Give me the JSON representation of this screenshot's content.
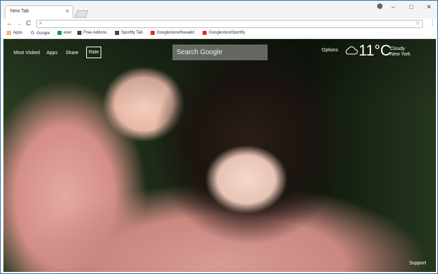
{
  "tab": {
    "title": "New Tab",
    "close": "×"
  },
  "window_controls": {
    "minimize": "–",
    "maximize": "□",
    "close": "✕"
  },
  "toolbar": {
    "back": "←",
    "forward": "→",
    "reload": "C",
    "search_icon": "⌕",
    "star": "☆",
    "menu": "⋮"
  },
  "bookmarks": [
    {
      "label": "Apps",
      "icon": "apps-grid-icon",
      "color": "#e8710a"
    },
    {
      "label": "Google",
      "icon": "google-icon",
      "color": "#4285f4"
    },
    {
      "label": "exel",
      "icon": "sheets-icon",
      "color": "#0f9d58"
    },
    {
      "label": "Free Addons",
      "icon": "addons-icon",
      "color": "#444444"
    },
    {
      "label": "Sportify Tab",
      "icon": "sportify-icon",
      "color": "#444444"
    },
    {
      "label": "Googlestore/freeadd",
      "icon": "store-icon",
      "color": "#d93025"
    },
    {
      "label": "GooglestoreSportify",
      "icon": "store-icon",
      "color": "#d93025"
    }
  ],
  "page": {
    "nav": [
      "Most Visited",
      "Apps",
      "Share"
    ],
    "rate": "Rate",
    "search_placeholder": "Search Google",
    "options": "Options",
    "weather": {
      "temp": "11°C",
      "condition": "Cloudy",
      "city": "New York",
      "icon": "cloud-icon"
    },
    "support": "Support"
  }
}
